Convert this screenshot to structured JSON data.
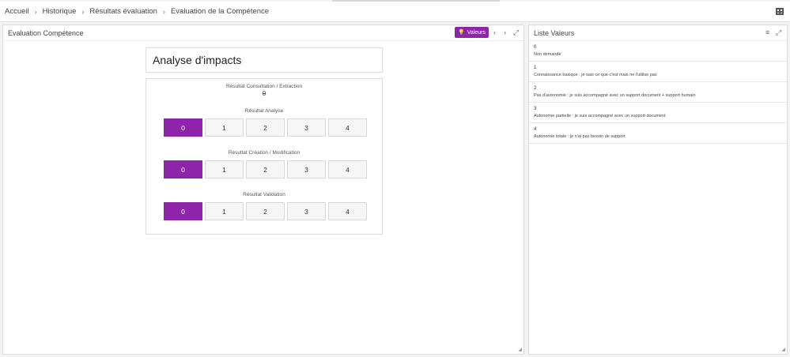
{
  "breadcrumb": {
    "items": [
      "Accueil",
      "Historique",
      "Résultats évaluation",
      "Evaluation de la Compétence"
    ]
  },
  "left_panel": {
    "title": "Evaluation Compétence",
    "valeurs_button": "Valeurs",
    "heading": "Analyse d'impacts",
    "consultation": {
      "label": "Résultat Consultation / Extraction",
      "value": "0"
    },
    "sections": [
      {
        "label": "Résultat Analyse",
        "options": [
          "0",
          "1",
          "2",
          "3",
          "4"
        ],
        "selected": "0"
      },
      {
        "label": "Résultat Création / Modification",
        "options": [
          "0",
          "1",
          "2",
          "3",
          "4"
        ],
        "selected": "0"
      },
      {
        "label": "Résultat Validation",
        "options": [
          "0",
          "1",
          "2",
          "3",
          "4"
        ],
        "selected": "0"
      }
    ]
  },
  "right_panel": {
    "title": "Liste Valeurs",
    "items": [
      {
        "value": "0",
        "desc": "Non demandé"
      },
      {
        "value": "1",
        "desc": "Connaissance basique : je sais ce que c'est mais ne l'utilise pas"
      },
      {
        "value": "2",
        "desc": "Pas d'autonomie : je suis accompagné avec un support document + support humain"
      },
      {
        "value": "3",
        "desc": "Autonomie partielle : je suis accompagné avec un support document"
      },
      {
        "value": "4",
        "desc": "Autonomie totale : je n'ai pas besoin de support"
      }
    ]
  },
  "icons": {
    "grid": "grid-layout-icon",
    "bulb": "lightbulb-icon",
    "prev": "chevron-left-icon",
    "next": "chevron-right-icon",
    "expand": "expand-icon",
    "filter": "filter-icon"
  },
  "colors": {
    "accent": "#8e24aa"
  }
}
